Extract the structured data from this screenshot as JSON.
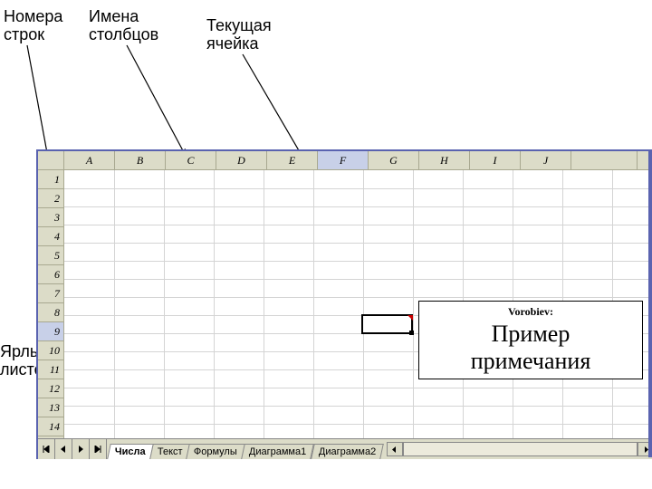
{
  "annotations": {
    "rowNumbers": "Номера\nстрок",
    "colNames": "Имена\nстолбцов",
    "currentCell": "Текущая\nячейка",
    "sheetTabs": "Ярлычки\nлистов"
  },
  "columns": [
    "A",
    "B",
    "C",
    "D",
    "E",
    "F",
    "G",
    "H",
    "I",
    "J"
  ],
  "selectedColumn": "F",
  "rows": [
    "1",
    "2",
    "3",
    "4",
    "5",
    "6",
    "7",
    "8",
    "9",
    "10",
    "11",
    "12",
    "13",
    "14"
  ],
  "selectedRow": "9",
  "tabs": {
    "items": [
      "Числа",
      "Текст",
      "Формулы",
      "Диаграмма1",
      "Диаграмма2"
    ],
    "active": 0
  },
  "comment": {
    "author": "Vorobiev:",
    "text": "Пример\nпримечания"
  }
}
